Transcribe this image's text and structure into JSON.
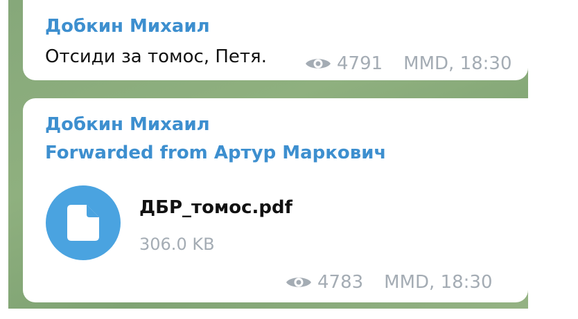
{
  "messages": [
    {
      "sender": "Добкин Михаил",
      "text": "Отсиди за томос, Петя.",
      "views": "4791",
      "timestamp": "MMD, 18:30"
    },
    {
      "sender": "Добкин Михаил",
      "forwarded_from": "Forwarded from Артур Маркович",
      "file": {
        "name": "ДБР_томос.pdf",
        "size": "306.0 KB",
        "icon": "document-icon"
      },
      "views": "4783",
      "timestamp": "MMD, 18:30"
    }
  ],
  "colors": {
    "accent": "#3d8fcf",
    "file_icon_bg": "#4aa3e0",
    "meta": "#a4acb4",
    "chat_background": "#8aab7b"
  }
}
